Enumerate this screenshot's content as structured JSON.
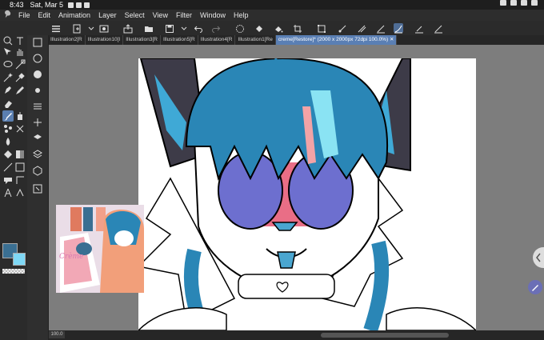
{
  "status": {
    "time": "8:43",
    "date": "Sat, Mar 5"
  },
  "menu": {
    "items": [
      "File",
      "Edit",
      "Animation",
      "Layer",
      "Select",
      "View",
      "Filter",
      "Window",
      "Help"
    ]
  },
  "tabs": [
    "Illustration2[R",
    "Illustration10[I",
    "Illustration3[R",
    "Illustration5[R",
    "Illustration4[R",
    "Illustration1[Re",
    "creme[Restore]* (2000 x 2000px 72dpi 100.0%)"
  ],
  "active_tab_index": 6,
  "zoom": {
    "value": "100.0"
  },
  "colors": {
    "accent": "#5a7fb4",
    "main_color": "#3a6f92",
    "sub_color": "#7fd8f5",
    "canvas_bg": "#7d7d7d"
  },
  "reference_image": {
    "caption": "Crème"
  }
}
